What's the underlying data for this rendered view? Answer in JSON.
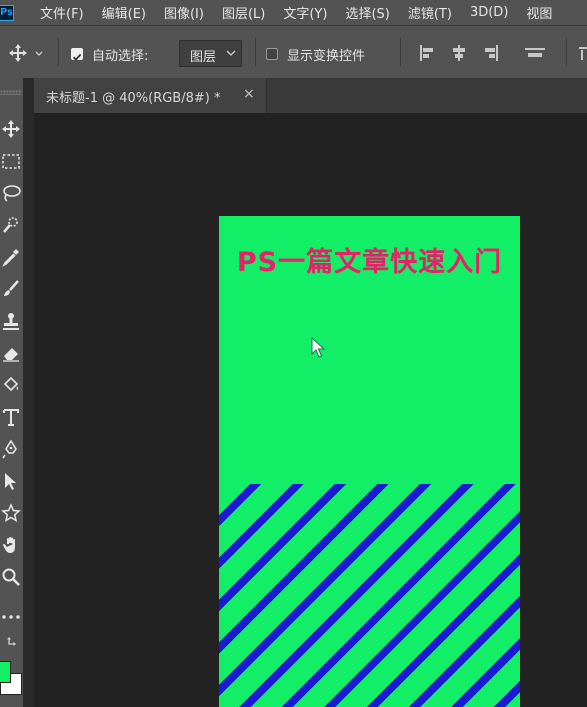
{
  "app": {
    "logo": "Ps"
  },
  "menu": [
    "文件(F)",
    "编辑(E)",
    "图像(I)",
    "图层(L)",
    "文字(Y)",
    "选择(S)",
    "滤镜(T)",
    "3D(D)",
    "视图"
  ],
  "options": {
    "auto_select_label": "自动选择:",
    "auto_select_checked": true,
    "layer_select_value": "图层",
    "show_transform_label": "显示变换控件",
    "show_transform_checked": false
  },
  "document_tab": {
    "title": "未标题-1 @ 40%(RGB/8#) *",
    "close": "×"
  },
  "canvas": {
    "heading": "PS一篇文章快速入门",
    "background_color": "#12ee66",
    "heading_color": "#e6216a",
    "stripe_color": "#1a1ad0"
  },
  "tools": [
    "move-icon",
    "marquee-icon",
    "lasso-icon",
    "quick-select-icon",
    "eyedropper-icon",
    "brush-icon",
    "stamp-icon",
    "eraser-icon",
    "bucket-icon",
    "type-icon",
    "pen-icon",
    "path-select-icon",
    "shape-icon",
    "hand-icon",
    "zoom-icon",
    "more-icon"
  ],
  "colors": {
    "foreground": "#12ee66",
    "background": "#ffffff",
    "accent": "#31a8ff"
  }
}
